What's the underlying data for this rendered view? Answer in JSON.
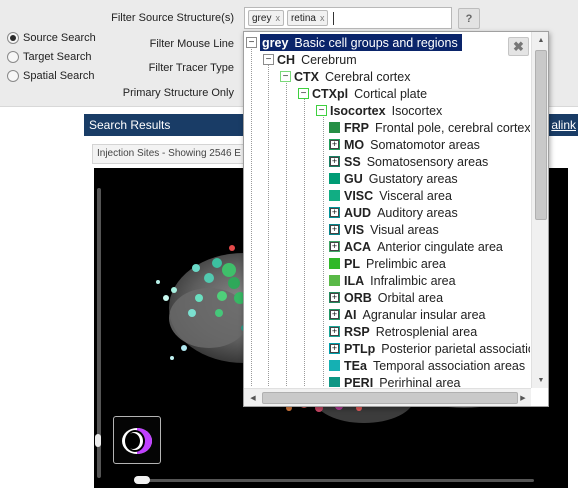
{
  "filters": {
    "source_structure_label": "Filter Source Structure(s)",
    "mouse_line_label": "Filter Mouse Line",
    "tracer_type_label": "Filter Tracer Type",
    "primary_only_label": "Primary Structure Only",
    "selected_tags": [
      {
        "label": "grey",
        "remove": "x"
      },
      {
        "label": "retina",
        "remove": "x"
      }
    ],
    "help_label": "?"
  },
  "search_modes": [
    {
      "label": "Source Search",
      "checked": true
    },
    {
      "label": "Target Search",
      "checked": false
    },
    {
      "label": "Spatial Search",
      "checked": false
    }
  ],
  "results": {
    "title": "Search Results",
    "permalink": "alink",
    "injection_sites_text": "Injection Sites - Showing 2546 E"
  },
  "tree": {
    "close_label": "✖",
    "rows": [
      {
        "acronym": "grey",
        "name": "Basic cell groups and regions",
        "color": "#bfdae3",
        "toggle": "−",
        "selected": true
      },
      {
        "acronym": "CH",
        "name": "Cerebrum",
        "color": "#b0f0ff",
        "toggle": "−"
      },
      {
        "acronym": "CTX",
        "name": "Cerebral cortex",
        "color": "#b0ffb8",
        "toggle": "−"
      },
      {
        "acronym": "CTXpl",
        "name": "Cortical plate",
        "color": "#70ff70",
        "toggle": "−"
      },
      {
        "acronym": "Isocortex",
        "name": "Isocortex",
        "color": "#70ff71",
        "toggle": "−"
      },
      {
        "acronym": "FRP",
        "name": "Frontal pole, cerebral cortex",
        "color": "#268f45",
        "toggle": ""
      },
      {
        "acronym": "MO",
        "name": "Somatomotor areas",
        "color": "#1f9d5a",
        "toggle": "+"
      },
      {
        "acronym": "SS",
        "name": "Somatosensory areas",
        "color": "#188064",
        "toggle": "+"
      },
      {
        "acronym": "GU",
        "name": "Gustatory areas",
        "color": "#009c75",
        "toggle": ""
      },
      {
        "acronym": "VISC",
        "name": "Visceral area",
        "color": "#11ad83",
        "toggle": ""
      },
      {
        "acronym": "AUD",
        "name": "Auditory areas",
        "color": "#019399",
        "toggle": "+"
      },
      {
        "acronym": "VIS",
        "name": "Visual areas",
        "color": "#08858c",
        "toggle": "+"
      },
      {
        "acronym": "ACA",
        "name": "Anterior cingulate area",
        "color": "#40a666",
        "toggle": "+"
      },
      {
        "acronym": "PL",
        "name": "Prelimbic area",
        "color": "#2fb828",
        "toggle": ""
      },
      {
        "acronym": "ILA",
        "name": "Infralimbic area",
        "color": "#59b947",
        "toggle": ""
      },
      {
        "acronym": "ORB",
        "name": "Orbital area",
        "color": "#248a5e",
        "toggle": "+"
      },
      {
        "acronym": "AI",
        "name": "Agranular insular area",
        "color": "#219866",
        "toggle": "+"
      },
      {
        "acronym": "RSP",
        "name": "Retrosplenial area",
        "color": "#1aa698",
        "toggle": "+"
      },
      {
        "acronym": "PTLp",
        "name": "Posterior parietal association",
        "color": "#009fac",
        "toggle": "+"
      },
      {
        "acronym": "TEa",
        "name": "Temporal association areas",
        "color": "#15b0b3",
        "toggle": ""
      },
      {
        "acronym": "PERI",
        "name": "Perirhinal area",
        "color": "#0e9684",
        "toggle": ""
      }
    ]
  }
}
